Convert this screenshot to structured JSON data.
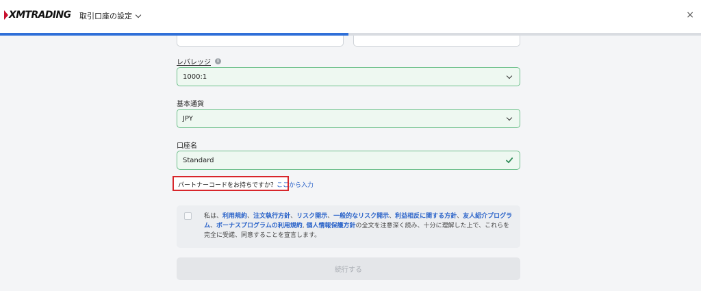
{
  "header": {
    "logo_text": "XMTRADING",
    "title": "取引口座の設定",
    "close_symbol": "×"
  },
  "progress": {
    "fraction": 0.5
  },
  "leverage": {
    "label": "レバレッジ",
    "value": "1000:1"
  },
  "currency": {
    "label": "基本通貨",
    "value": "JPY"
  },
  "account_name": {
    "label": "口座名",
    "value": "Standard"
  },
  "partner": {
    "question": "パートナーコードをお持ちですか？",
    "link": "ここから入力"
  },
  "terms": {
    "segments": [
      {
        "text": "私は、",
        "link": false
      },
      {
        "text": "利用規約",
        "link": true
      },
      {
        "text": "、",
        "link": false
      },
      {
        "text": "注文執行方針",
        "link": true
      },
      {
        "text": "、",
        "link": false
      },
      {
        "text": "リスク開示",
        "link": true
      },
      {
        "text": "、",
        "link": false
      },
      {
        "text": "一般的なリスク開示",
        "link": true
      },
      {
        "text": "、",
        "link": false
      },
      {
        "text": "利益相反に関する方針",
        "link": true
      },
      {
        "text": "、",
        "link": false
      },
      {
        "text": "友人紹介プログラム",
        "link": true
      },
      {
        "text": "、",
        "link": false
      },
      {
        "text": "ボーナスプログラムの利用規約",
        "link": true
      },
      {
        "text": ", ",
        "link": false
      },
      {
        "text": "個人情報保護方針",
        "link": true
      },
      {
        "text": "の全文を注意深く読み、十分に理解した上で、これらを完全に受諾、同意することを宣言します。",
        "link": false
      }
    ]
  },
  "continue_label": "続行する",
  "colors": {
    "accent": "#2f6fd8",
    "valid_border": "#6cbf8a",
    "link": "#2a63c9",
    "highlight": "#d8262b"
  }
}
